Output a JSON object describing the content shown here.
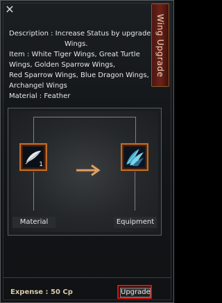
{
  "window": {
    "title": "Wing Upgrade",
    "close_glyph": "✕"
  },
  "description": {
    "lines": [
      "Description : Increase Status by upgrade",
      "Wings.",
      "Item : White Tiger Wings, Great Turtle",
      "Wings, Golden Sparrow Wings,",
      "Red Sparrow Wings, Blue Dragon Wings,",
      "Archangel Wings",
      "Material : Feather"
    ]
  },
  "recipe": {
    "material": {
      "label": "Material",
      "quantity": "1",
      "icon": "feather-icon"
    },
    "result": {
      "label": "Equipment",
      "icon": "blue-wings-icon"
    },
    "arrow_icon": "right-arrow-icon"
  },
  "footer": {
    "expense": "Expense : 50 Cp",
    "upgrade_label": "Upgrade"
  },
  "colors": {
    "slot_border": "#c26b25",
    "highlight": "#e01010",
    "title_tab": "#6e2219"
  }
}
